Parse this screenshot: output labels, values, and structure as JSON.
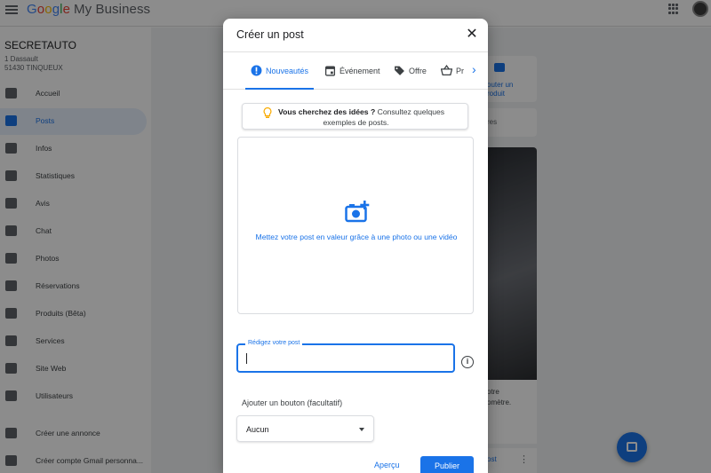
{
  "app": {
    "brand_google": "Google",
    "brand_product": "My Business"
  },
  "business": {
    "name": "SECRETAUTO",
    "address_line1": "1 Dassault",
    "address_line2": "51430 TINQUEUX"
  },
  "sidebar": {
    "items": [
      {
        "label": "Accueil",
        "icon": "dashboard-icon"
      },
      {
        "label": "Posts",
        "icon": "posts-icon",
        "active": true
      },
      {
        "label": "Infos",
        "icon": "store-icon"
      },
      {
        "label": "Statistiques",
        "icon": "bar-chart-icon"
      },
      {
        "label": "Avis",
        "icon": "review-icon"
      },
      {
        "label": "Chat",
        "icon": "chat-icon"
      },
      {
        "label": "Photos",
        "icon": "photo-icon"
      },
      {
        "label": "Réservations",
        "icon": "calendar-icon"
      },
      {
        "label": "Produits (Bêta)",
        "icon": "basket-icon"
      },
      {
        "label": "Services",
        "icon": "list-icon"
      },
      {
        "label": "Site Web",
        "icon": "website-icon"
      },
      {
        "label": "Utilisateurs",
        "icon": "add-user-icon"
      },
      {
        "label": "Créer une annonce",
        "icon": "ads-icon"
      },
      {
        "label": "Créer compte Gmail personna...",
        "icon": "mail-icon"
      }
    ]
  },
  "background": {
    "card_a_text": "outer un\nroduit",
    "card_b_text": "res",
    "card_c_text": "otre\nomètre.",
    "card_d_link": "ost"
  },
  "dialog": {
    "title": "Créer un post",
    "tabs": [
      {
        "label": "Nouveautés",
        "icon": "alert-circle-icon",
        "active": true
      },
      {
        "label": "Événement",
        "icon": "event-icon"
      },
      {
        "label": "Offre",
        "icon": "tag-icon"
      },
      {
        "label": "Pr",
        "icon": "basket-icon"
      }
    ],
    "tips_bold": "Vous cherchez des idées ?",
    "tips_rest": " Consultez quelques",
    "tips_line2": "exemples de posts.",
    "photo_prompt": "Mettez votre post en valeur grâce à une photo ou une vidéo",
    "post_field_label": "Rédigez votre post",
    "post_field_value": "",
    "button_heading": "Ajouter un bouton (facultatif)",
    "button_select_value": "Aucun",
    "preview_label": "Aperçu",
    "publish_label": "Publier"
  },
  "colors": {
    "accent": "#1a73e8",
    "tip_bulb": "#f9ab00"
  }
}
